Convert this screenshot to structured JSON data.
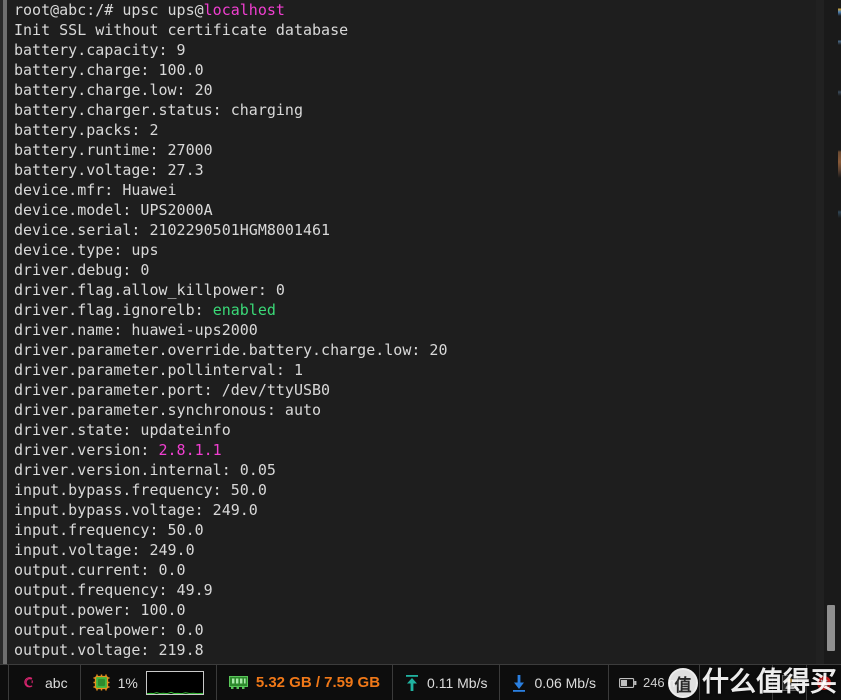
{
  "terminal": {
    "lines": [
      {
        "segments": [
          {
            "text": "root@abc:/# upsc ups@",
            "color": "default"
          },
          {
            "text": "localhost",
            "color": "magenta"
          }
        ]
      },
      {
        "segments": [
          {
            "text": "Init SSL without certificate database",
            "color": "default"
          }
        ]
      },
      {
        "segments": [
          {
            "text": "battery.capacity: 9",
            "color": "default"
          }
        ]
      },
      {
        "segments": [
          {
            "text": "battery.charge: 100.0",
            "color": "default"
          }
        ]
      },
      {
        "segments": [
          {
            "text": "battery.charge.low: 20",
            "color": "default"
          }
        ]
      },
      {
        "segments": [
          {
            "text": "battery.charger.status: charging",
            "color": "default"
          }
        ]
      },
      {
        "segments": [
          {
            "text": "battery.packs: 2",
            "color": "default"
          }
        ]
      },
      {
        "segments": [
          {
            "text": "battery.runtime: 27000",
            "color": "default"
          }
        ]
      },
      {
        "segments": [
          {
            "text": "battery.voltage: 27.3",
            "color": "default"
          }
        ]
      },
      {
        "segments": [
          {
            "text": "device.mfr: Huawei",
            "color": "default"
          }
        ]
      },
      {
        "segments": [
          {
            "text": "device.model: UPS2000A",
            "color": "default"
          }
        ]
      },
      {
        "segments": [
          {
            "text": "device.serial: 2102290501HGM8001461",
            "color": "default"
          }
        ]
      },
      {
        "segments": [
          {
            "text": "device.type: ups",
            "color": "default"
          }
        ]
      },
      {
        "segments": [
          {
            "text": "driver.debug: 0",
            "color": "default"
          }
        ]
      },
      {
        "segments": [
          {
            "text": "driver.flag.allow_killpower: 0",
            "color": "default"
          }
        ]
      },
      {
        "segments": [
          {
            "text": "driver.flag.ignorelb: ",
            "color": "default"
          },
          {
            "text": "enabled",
            "color": "green"
          }
        ]
      },
      {
        "segments": [
          {
            "text": "driver.name: huawei-ups2000",
            "color": "default"
          }
        ]
      },
      {
        "segments": [
          {
            "text": "driver.parameter.override.battery.charge.low: 20",
            "color": "default"
          }
        ]
      },
      {
        "segments": [
          {
            "text": "driver.parameter.pollinterval: 1",
            "color": "default"
          }
        ]
      },
      {
        "segments": [
          {
            "text": "driver.parameter.port: /dev/ttyUSB0",
            "color": "default"
          }
        ]
      },
      {
        "segments": [
          {
            "text": "driver.parameter.synchronous: auto",
            "color": "default"
          }
        ]
      },
      {
        "segments": [
          {
            "text": "driver.state: updateinfo",
            "color": "default"
          }
        ]
      },
      {
        "segments": [
          {
            "text": "driver.version: ",
            "color": "default"
          },
          {
            "text": "2.8.1.1",
            "color": "magenta"
          }
        ]
      },
      {
        "segments": [
          {
            "text": "driver.version.internal: 0.05",
            "color": "default"
          }
        ]
      },
      {
        "segments": [
          {
            "text": "input.bypass.frequency: 50.0",
            "color": "default"
          }
        ]
      },
      {
        "segments": [
          {
            "text": "input.bypass.voltage: 249.0",
            "color": "default"
          }
        ]
      },
      {
        "segments": [
          {
            "text": "input.frequency: 50.0",
            "color": "default"
          }
        ]
      },
      {
        "segments": [
          {
            "text": "input.voltage: 249.0",
            "color": "default"
          }
        ]
      },
      {
        "segments": [
          {
            "text": "output.current: 0.0",
            "color": "default"
          }
        ]
      },
      {
        "segments": [
          {
            "text": "output.frequency: 49.9",
            "color": "default"
          }
        ]
      },
      {
        "segments": [
          {
            "text": "output.power: 100.0",
            "color": "default"
          }
        ]
      },
      {
        "segments": [
          {
            "text": "output.realpower: 0.0",
            "color": "default"
          }
        ]
      },
      {
        "segments": [
          {
            "text": "output.voltage: 219.8",
            "color": "default"
          }
        ]
      }
    ],
    "colors": {
      "background": "#1e1e1e",
      "foreground": "#d8d8d8",
      "magenta": "#f03fd0",
      "green": "#3ad977"
    }
  },
  "statusbar": {
    "os": {
      "icon": "debian-swirl-icon",
      "label": "abc",
      "icon_color": "#d7246e"
    },
    "cpu": {
      "icon": "cpu-chip-icon",
      "label": "1%",
      "graph_line_color": "#39c039"
    },
    "memory": {
      "icon": "ram-stick-icon",
      "label": "5.32 GB / 7.59 GB",
      "color": "#f07818",
      "used": "5.32 GB",
      "total": "7.59 GB"
    },
    "network_up": {
      "icon": "upload-arrow-icon",
      "label": "0.11 Mb/s",
      "icon_color": "#20b2a0"
    },
    "network_down": {
      "icon": "download-arrow-icon",
      "label": "0.06 Mb/s",
      "icon_color": "#2a7fe0"
    },
    "battery": {
      "icon": "battery-icon",
      "label": "246 min"
    },
    "tray": [
      {
        "icon": "person-tray-icon"
      },
      {
        "icon": "red-circle-tray-icon",
        "color": "#e02020"
      }
    ]
  },
  "watermark": {
    "badge": "值",
    "text": "什么值得买"
  }
}
